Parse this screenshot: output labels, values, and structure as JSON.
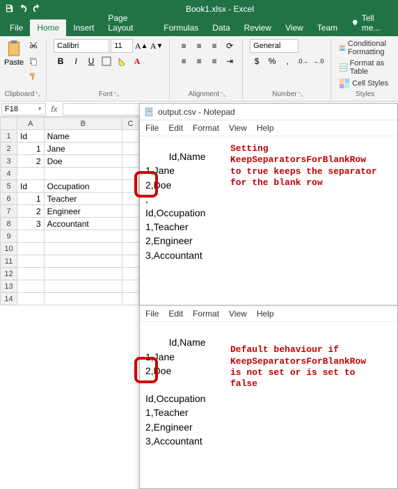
{
  "app": {
    "title": "Book1.xlsx - Excel"
  },
  "tabs": {
    "file": "File",
    "home": "Home",
    "insert": "Insert",
    "page_layout": "Page Layout",
    "formulas": "Formulas",
    "data": "Data",
    "review": "Review",
    "view": "View",
    "team": "Team",
    "tellme": "Tell me..."
  },
  "ribbon": {
    "clipboard": {
      "paste": "Paste",
      "label": "Clipboard"
    },
    "font": {
      "name": "Calibri",
      "size": "11",
      "label": "Font"
    },
    "alignment": {
      "label": "Alignment"
    },
    "number": {
      "format": "General",
      "label": "Number"
    },
    "styles": {
      "cond": "Conditional Formatting",
      "table": "Format as Table",
      "cell": "Cell Styles",
      "label": "Styles"
    }
  },
  "namebox": "F18",
  "cells": {
    "headers": [
      "",
      "A",
      "B",
      "C"
    ],
    "rows": [
      {
        "r": "1",
        "a": "Id",
        "b": "Name"
      },
      {
        "r": "2",
        "a": "1",
        "b": "Jane"
      },
      {
        "r": "3",
        "a": "2",
        "b": "Doe"
      },
      {
        "r": "4",
        "a": "",
        "b": ""
      },
      {
        "r": "5",
        "a": "Id",
        "b": "Occupation"
      },
      {
        "r": "6",
        "a": "1",
        "b": "Teacher"
      },
      {
        "r": "7",
        "a": "2",
        "b": "Engineer"
      },
      {
        "r": "8",
        "a": "3",
        "b": "Accountant"
      },
      {
        "r": "9",
        "a": "",
        "b": ""
      },
      {
        "r": "10",
        "a": "",
        "b": ""
      },
      {
        "r": "11",
        "a": "",
        "b": ""
      },
      {
        "r": "12",
        "a": "",
        "b": ""
      },
      {
        "r": "13",
        "a": "",
        "b": ""
      },
      {
        "r": "14",
        "a": "",
        "b": ""
      }
    ]
  },
  "notepad": {
    "title": "output.csv - Notepad",
    "menu": {
      "file": "File",
      "edit": "Edit",
      "format": "Format",
      "view": "View",
      "help": "Help"
    },
    "block1": "Id,Name\n1,Jane\n2,Doe\n,\nId,Occupation\n1,Teacher\n2,Engineer\n3,Accountant",
    "block2": "Id,Name\n1,Jane\n2,Doe\n\nId,Occupation\n1,Teacher\n2,Engineer\n3,Accountant"
  },
  "annotations": {
    "a1": "Setting\nKeepSeparatorsForBlankRow\nto true keeps the separator\nfor the blank row",
    "a2": "Default behaviour if\nKeepSeparatorsForBlankRow\nis not set or is set to\nfalse"
  }
}
